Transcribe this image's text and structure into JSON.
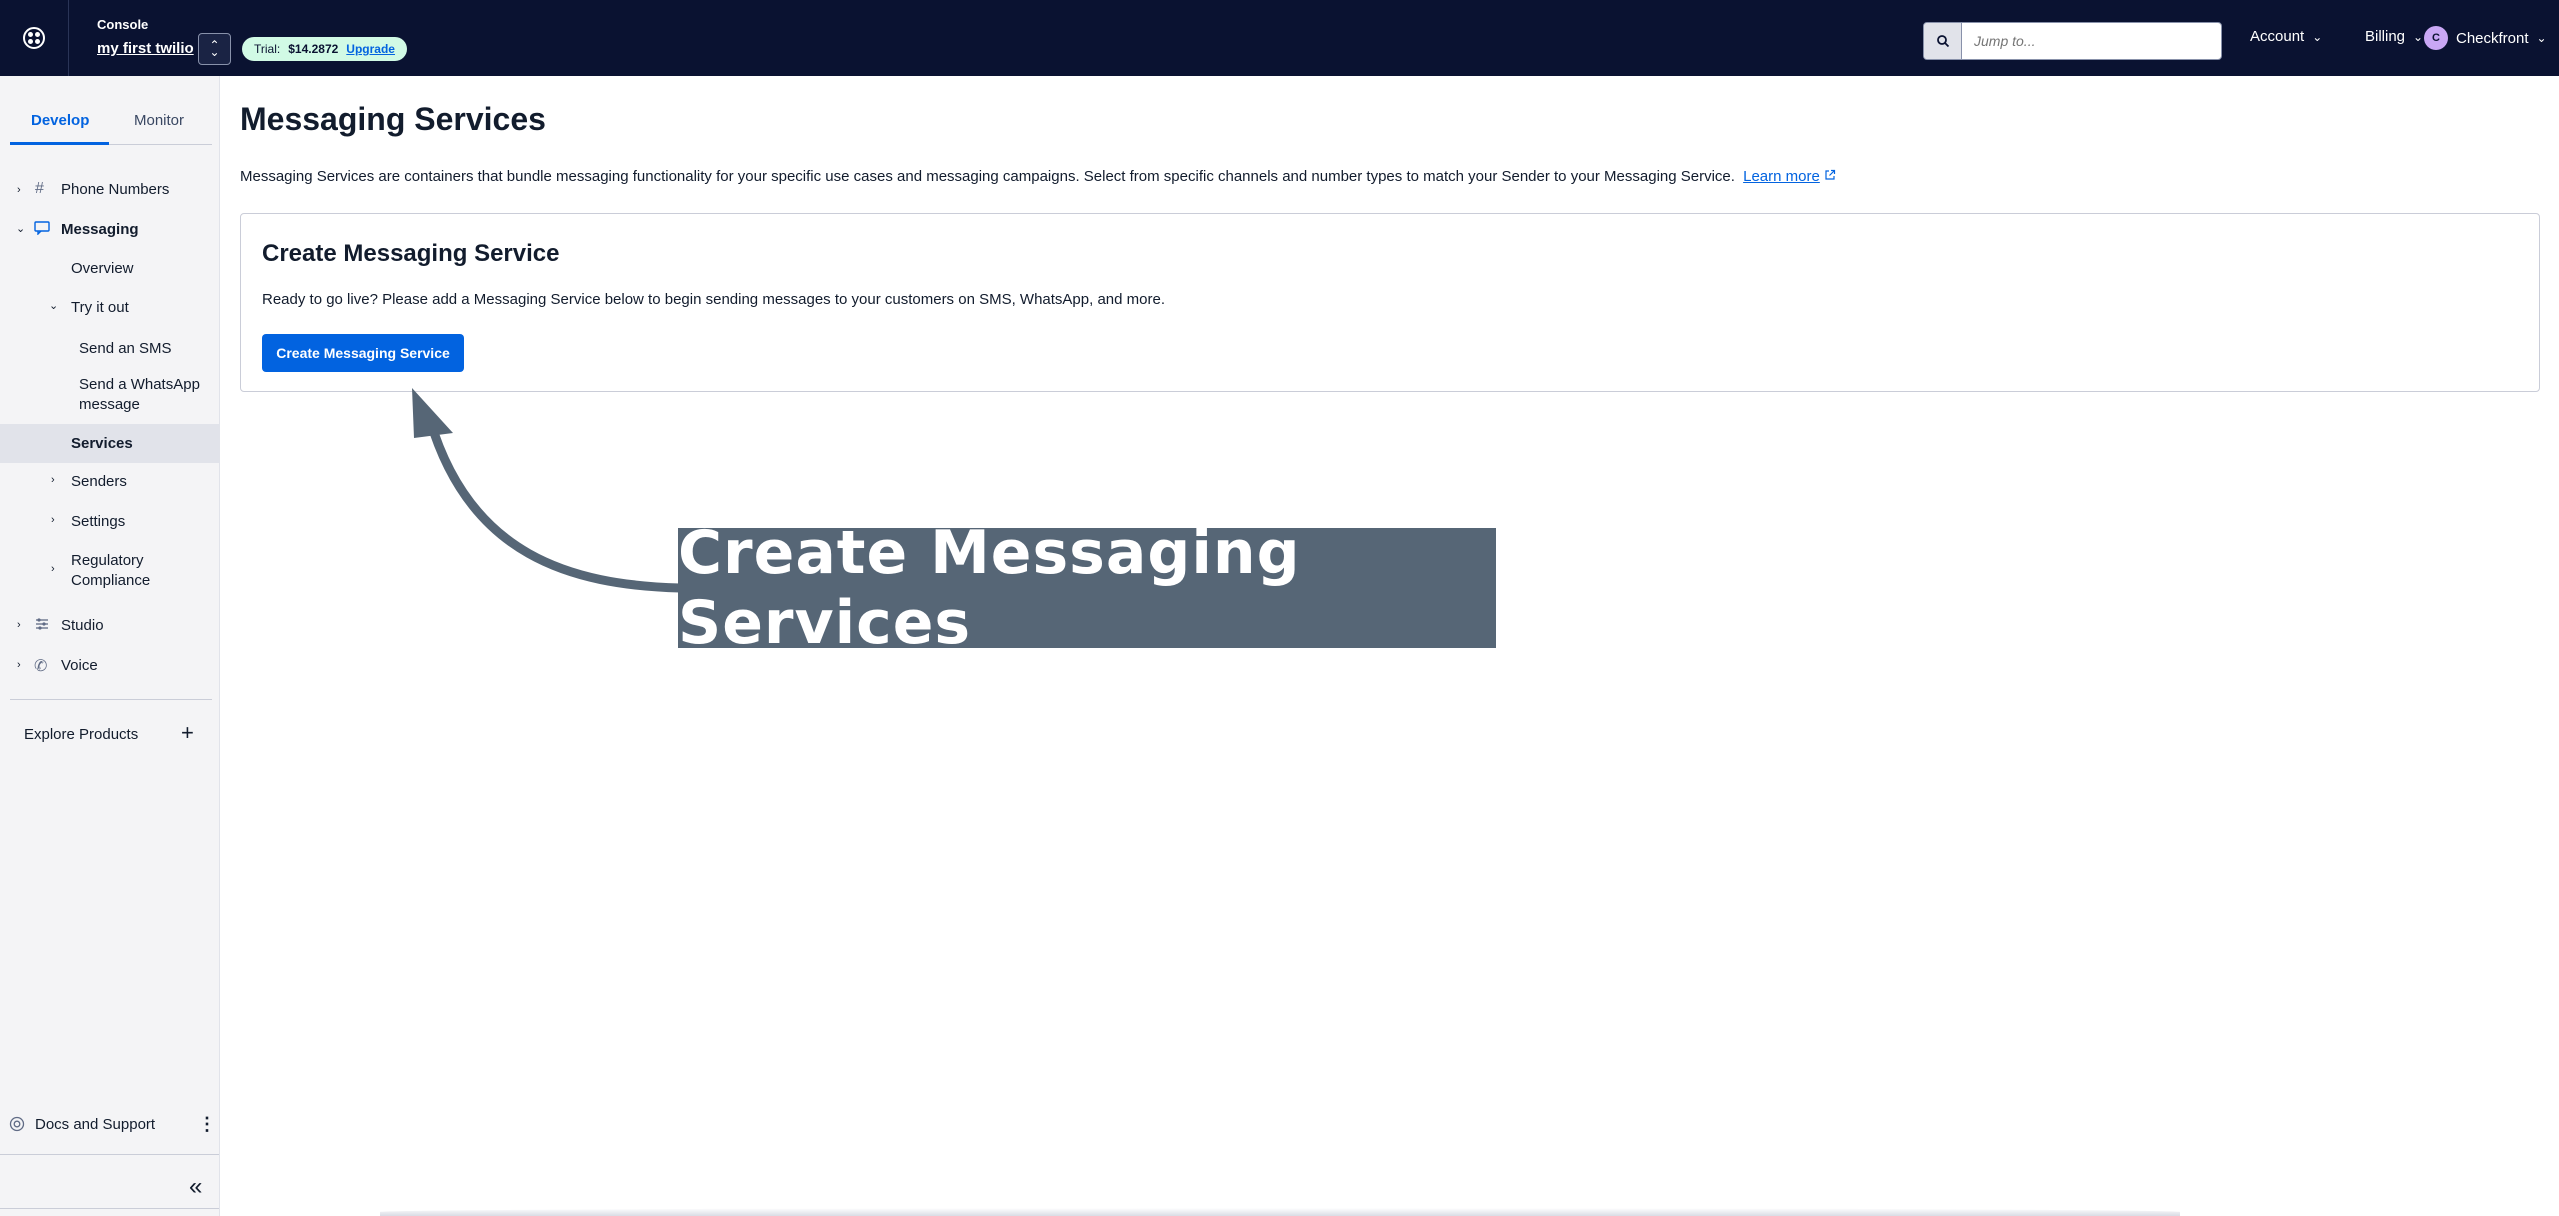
{
  "topbar": {
    "console_label": "Console",
    "project_name": "my first twilio",
    "trial_label": "Trial:",
    "trial_amount": "$14.2872",
    "upgrade_label": "Upgrade",
    "search_placeholder": "Jump to...",
    "account_label": "Account",
    "billing_label": "Billing",
    "user_initial": "C",
    "user_name": "Checkfront"
  },
  "sidebar": {
    "tab_develop": "Develop",
    "tab_monitor": "Monitor",
    "phone_numbers": "Phone Numbers",
    "messaging": "Messaging",
    "overview": "Overview",
    "try_it_out": "Try it out",
    "send_sms": "Send an SMS",
    "send_whatsapp_1": "Send a WhatsApp",
    "send_whatsapp_2": "message",
    "services": "Services",
    "senders": "Senders",
    "settings": "Settings",
    "regulatory_1": "Regulatory",
    "regulatory_2": "Compliance",
    "studio": "Studio",
    "voice": "Voice",
    "explore_products": "Explore Products",
    "docs_support": "Docs and Support"
  },
  "main": {
    "title": "Messaging Services",
    "description": "Messaging Services are containers that bundle messaging functionality for your specific use cases and messaging campaigns. Select from specific channels and number types to match your Sender to your Messaging Service.",
    "learn_more": "Learn more",
    "card_title": "Create Messaging Service",
    "card_text": "Ready to go live? Please add a Messaging Service below to begin sending messages to your customers on SMS, WhatsApp, and more.",
    "create_button": "Create Messaging Service"
  },
  "annotation": {
    "text": "Create Messaging Services"
  },
  "colors": {
    "topbar_bg": "#0a1231",
    "primary": "#0263e0",
    "annotation_bg": "#566676"
  }
}
